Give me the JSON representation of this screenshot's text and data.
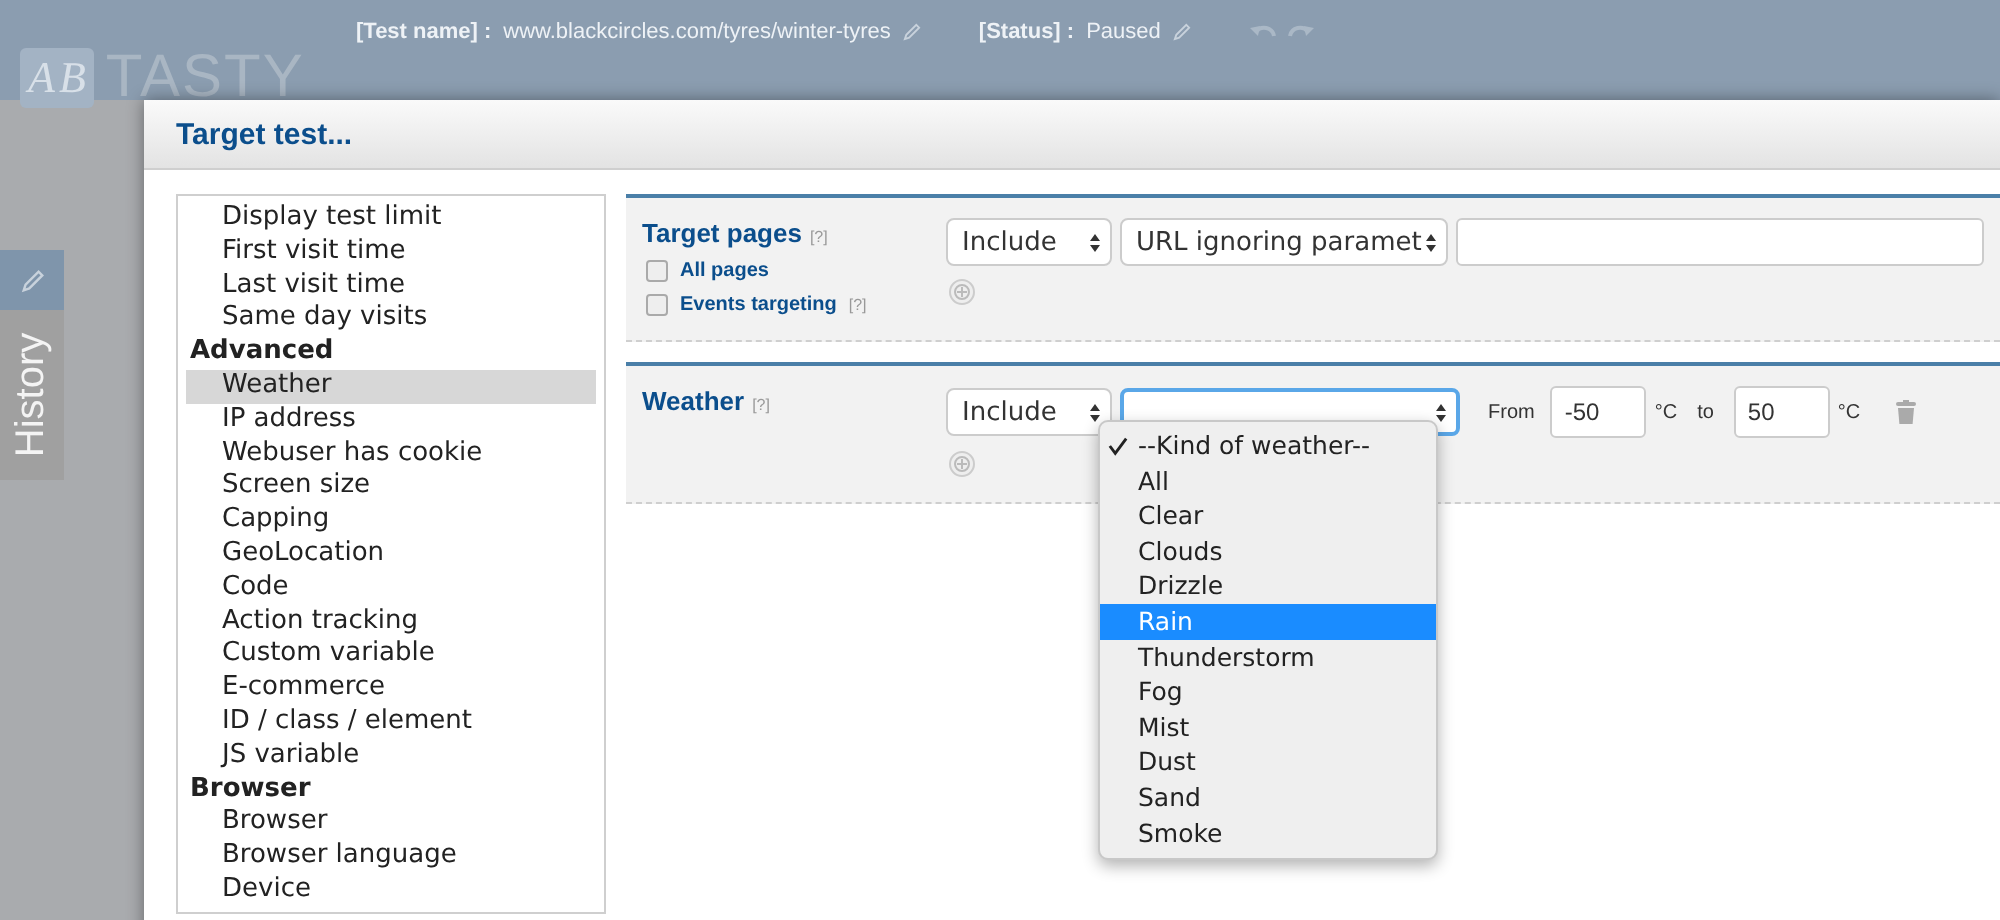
{
  "app": {
    "logo_letters": [
      "A",
      "B"
    ],
    "logo_text": "TASTY",
    "test_name_label": "[Test name] :",
    "test_name": "www.blackcircles.com/tyres/winter-tyres",
    "status_label": "[Status] :",
    "status": "Paused",
    "side_tab": "History"
  },
  "dialog": {
    "title": "Target test..."
  },
  "criteria": [
    {
      "label": "Display test limit",
      "kind": "item",
      "selected": false
    },
    {
      "label": "First visit time",
      "kind": "item",
      "selected": false
    },
    {
      "label": "Last visit time",
      "kind": "item",
      "selected": false
    },
    {
      "label": "Same day visits",
      "kind": "item",
      "selected": false
    },
    {
      "label": "Advanced",
      "kind": "group",
      "selected": false
    },
    {
      "label": "Weather",
      "kind": "item",
      "selected": true
    },
    {
      "label": "IP address",
      "kind": "item",
      "selected": false
    },
    {
      "label": "Webuser has cookie",
      "kind": "item",
      "selected": false
    },
    {
      "label": "Screen size",
      "kind": "item",
      "selected": false
    },
    {
      "label": "Capping",
      "kind": "item",
      "selected": false
    },
    {
      "label": "GeoLocation",
      "kind": "item",
      "selected": false
    },
    {
      "label": "Code",
      "kind": "item",
      "selected": false
    },
    {
      "label": "Action tracking",
      "kind": "item",
      "selected": false
    },
    {
      "label": "Custom variable",
      "kind": "item",
      "selected": false
    },
    {
      "label": "E-commerce",
      "kind": "item",
      "selected": false
    },
    {
      "label": "ID / class / element",
      "kind": "item",
      "selected": false
    },
    {
      "label": "JS variable",
      "kind": "item",
      "selected": false
    },
    {
      "label": "Browser",
      "kind": "group",
      "selected": false
    },
    {
      "label": "Browser",
      "kind": "item",
      "selected": false
    },
    {
      "label": "Browser language",
      "kind": "item",
      "selected": false
    },
    {
      "label": "Device",
      "kind": "item",
      "selected": false
    }
  ],
  "target_pages": {
    "title": "Target pages",
    "help": "[?]",
    "operator": "Include",
    "match": "URL ignoring paramet",
    "options": [
      {
        "label": "All pages",
        "checked": false
      },
      {
        "label": "Events targeting",
        "help": "[?]",
        "checked": false
      }
    ]
  },
  "weather": {
    "title": "Weather",
    "help": "[?]",
    "operator": "Include",
    "from_label": "From",
    "from": "-50",
    "unit_from": "°C",
    "to_label": "to",
    "to": "50",
    "unit_to": "°C",
    "menu": [
      {
        "label": "--Kind of weather--",
        "checked": true,
        "selected": false
      },
      {
        "label": "All",
        "checked": false,
        "selected": false
      },
      {
        "label": "Clear",
        "checked": false,
        "selected": false
      },
      {
        "label": "Clouds",
        "checked": false,
        "selected": false
      },
      {
        "label": "Drizzle",
        "checked": false,
        "selected": false
      },
      {
        "label": "Rain",
        "checked": false,
        "selected": true
      },
      {
        "label": "Thunderstorm",
        "checked": false,
        "selected": false
      },
      {
        "label": "Fog",
        "checked": false,
        "selected": false
      },
      {
        "label": "Mist",
        "checked": false,
        "selected": false
      },
      {
        "label": "Dust",
        "checked": false,
        "selected": false
      },
      {
        "label": "Sand",
        "checked": false,
        "selected": false
      },
      {
        "label": "Smoke",
        "checked": false,
        "selected": false
      }
    ]
  }
}
